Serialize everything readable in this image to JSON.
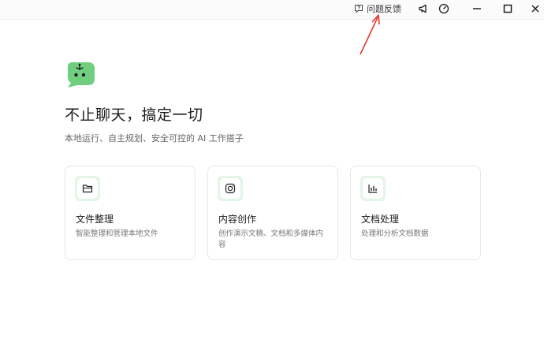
{
  "titlebar": {
    "feedback_label": "问题反馈",
    "icons": [
      "help-icon",
      "megaphone-icon",
      "gauge-icon",
      "minimize-icon",
      "maximize-icon",
      "close-icon"
    ]
  },
  "hero": {
    "headline": "不止聊天，搞定一切",
    "subtitle": "本地运行、自主规划、安全可控的 AI 工作搭子"
  },
  "cards": [
    {
      "title": "文件整理",
      "desc": "智能整理和管理本地文件",
      "icon": "folder-icon"
    },
    {
      "title": "内容创作",
      "desc": "创作演示文稿、文档和多媒体内容",
      "icon": "camera-icon"
    },
    {
      "title": "文档处理",
      "desc": "处理和分析文档数据",
      "icon": "bar-chart-icon"
    }
  ],
  "colors": {
    "accent": "#6fcf7f",
    "icon_bg": "#e4f4e6",
    "annotation": "#e23b2e"
  }
}
